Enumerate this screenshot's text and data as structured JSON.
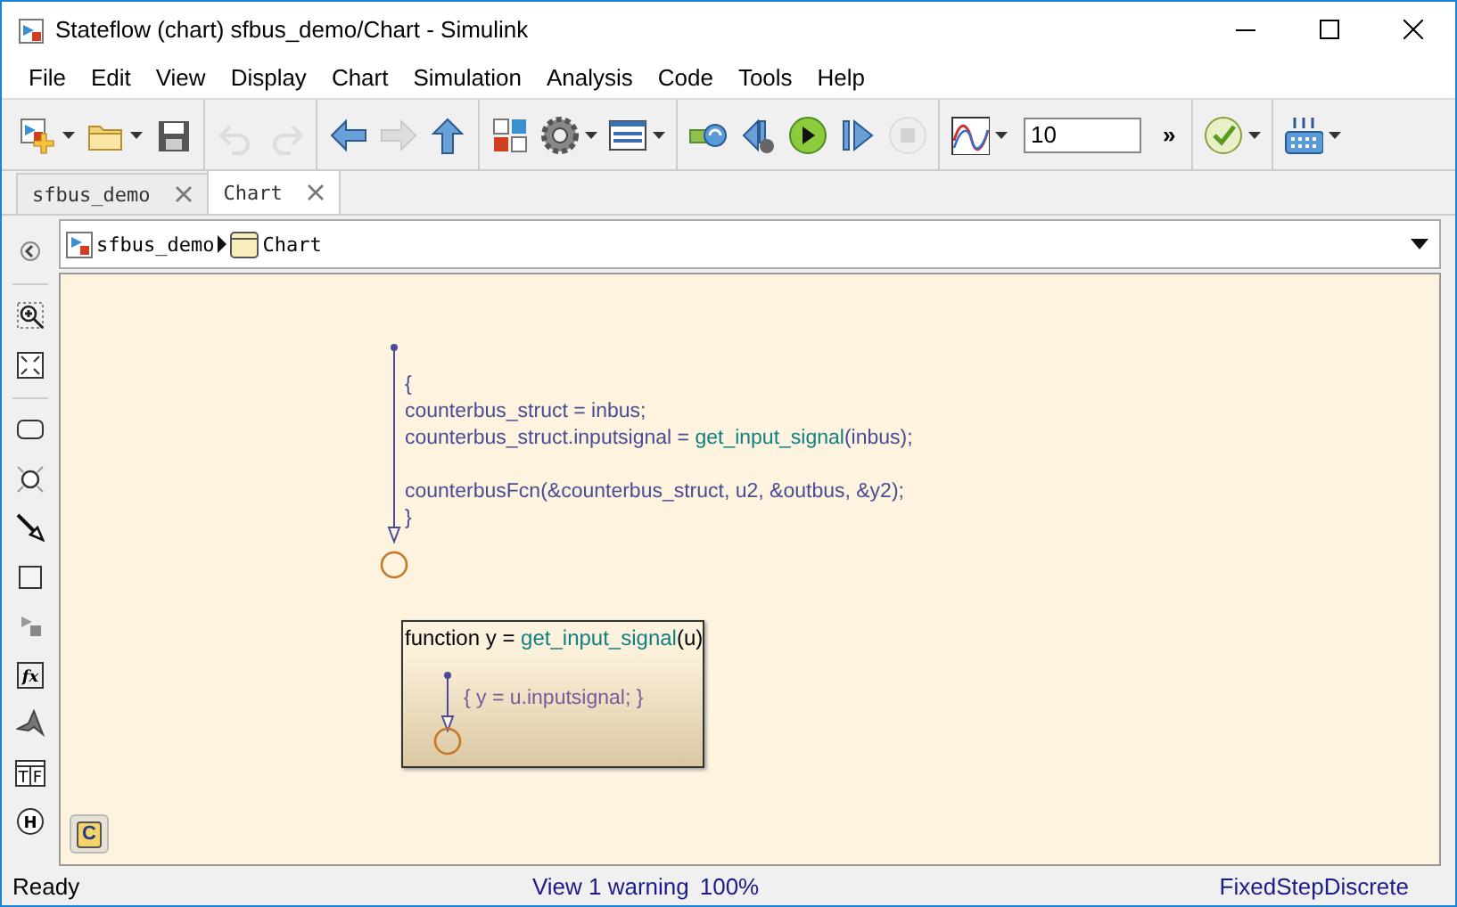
{
  "window": {
    "title": "Stateflow (chart) sfbus_demo/Chart - Simulink"
  },
  "menu": [
    {
      "label": "File"
    },
    {
      "label": "Edit"
    },
    {
      "label": "View"
    },
    {
      "label": "Display"
    },
    {
      "label": "Chart"
    },
    {
      "label": "Simulation"
    },
    {
      "label": "Analysis"
    },
    {
      "label": "Code"
    },
    {
      "label": "Tools"
    },
    {
      "label": "Help"
    }
  ],
  "toolbar": [
    {
      "kind": "new-model",
      "dropdown": true,
      "disabled": false
    },
    {
      "kind": "open",
      "dropdown": true,
      "disabled": false
    },
    {
      "kind": "save",
      "dropdown": false,
      "disabled": false
    },
    {
      "kind": "separator"
    },
    {
      "kind": "undo",
      "dropdown": false,
      "disabled": true
    },
    {
      "kind": "redo",
      "dropdown": false,
      "disabled": true
    },
    {
      "kind": "separator"
    },
    {
      "kind": "back",
      "dropdown": false,
      "disabled": false
    },
    {
      "kind": "forward",
      "dropdown": false,
      "disabled": true
    },
    {
      "kind": "up",
      "dropdown": false,
      "disabled": false
    },
    {
      "kind": "separator"
    },
    {
      "kind": "library",
      "dropdown": false,
      "disabled": false
    },
    {
      "kind": "gear",
      "dropdown": true,
      "disabled": false
    },
    {
      "kind": "table",
      "dropdown": true,
      "disabled": false
    },
    {
      "kind": "separator"
    },
    {
      "kind": "update",
      "dropdown": false,
      "disabled": false
    },
    {
      "kind": "step-back",
      "dropdown": false,
      "disabled": false
    },
    {
      "kind": "run",
      "dropdown": false,
      "disabled": false
    },
    {
      "kind": "step-forward",
      "dropdown": false,
      "disabled": false
    },
    {
      "kind": "stop",
      "dropdown": false,
      "disabled": true
    },
    {
      "kind": "separator"
    },
    {
      "kind": "scope",
      "dropdown": true,
      "disabled": false
    },
    {
      "kind": "field",
      "value": "10"
    },
    {
      "kind": "more",
      "label": "»"
    },
    {
      "kind": "separator"
    },
    {
      "kind": "check",
      "dropdown": true,
      "disabled": false
    },
    {
      "kind": "separator"
    },
    {
      "kind": "keypad",
      "dropdown": true,
      "disabled": false
    }
  ],
  "tabs": [
    {
      "label": "sfbus_demo",
      "selected": false
    },
    {
      "label": "Chart",
      "selected": true
    }
  ],
  "breadcrumb": [
    {
      "label": "sfbus_demo",
      "kind": "model"
    },
    {
      "label": "Chart",
      "kind": "chart"
    }
  ],
  "palette": [
    {
      "kind": "zoom"
    },
    {
      "kind": "fit"
    },
    {
      "kind": "separator"
    },
    {
      "kind": "state"
    },
    {
      "kind": "junction"
    },
    {
      "kind": "transition"
    },
    {
      "kind": "box"
    },
    {
      "kind": "simulink-function"
    },
    {
      "kind": "graphical-function",
      "glyph": "fx"
    },
    {
      "kind": "matlab-function"
    },
    {
      "kind": "truth-table",
      "glyph": "T",
      "glyph_2": "F"
    },
    {
      "kind": "history",
      "glyph": "H"
    }
  ],
  "chart": {
    "code": [
      {
        "lines": [
          [
            {
              "kind": "plain",
              "text": "{"
            }
          ],
          [
            {
              "kind": "plain",
              "text": "counterbus_struct = inbus;"
            }
          ],
          [
            {
              "kind": "plain",
              "text": "counterbus_struct.inputsignal = "
            },
            {
              "kind": "function",
              "text": "get_input_signal"
            },
            {
              "kind": "plain",
              "text": "(inbus);"
            }
          ]
        ]
      },
      {
        "lines": [
          [
            {
              "kind": "plain",
              "text": "counterbusFcn(&counterbus_struct, u2, &outbus, &y2);"
            }
          ],
          [
            {
              "kind": "plain",
              "text": "}"
            }
          ]
        ]
      }
    ],
    "function_box": {
      "header": [
        {
          "kind": "keyword",
          "text": "function  y = "
        },
        {
          "kind": "function",
          "text": "get_input_signal"
        },
        {
          "kind": "keyword",
          "text": "(u)"
        }
      ],
      "action": "{ y = u.inputsignal; }"
    },
    "badge": "C"
  },
  "status_bar": {
    "status": "Ready",
    "link": "View 1 warning",
    "zoom": "100%",
    "solver": "FixedStepDiscrete"
  }
}
